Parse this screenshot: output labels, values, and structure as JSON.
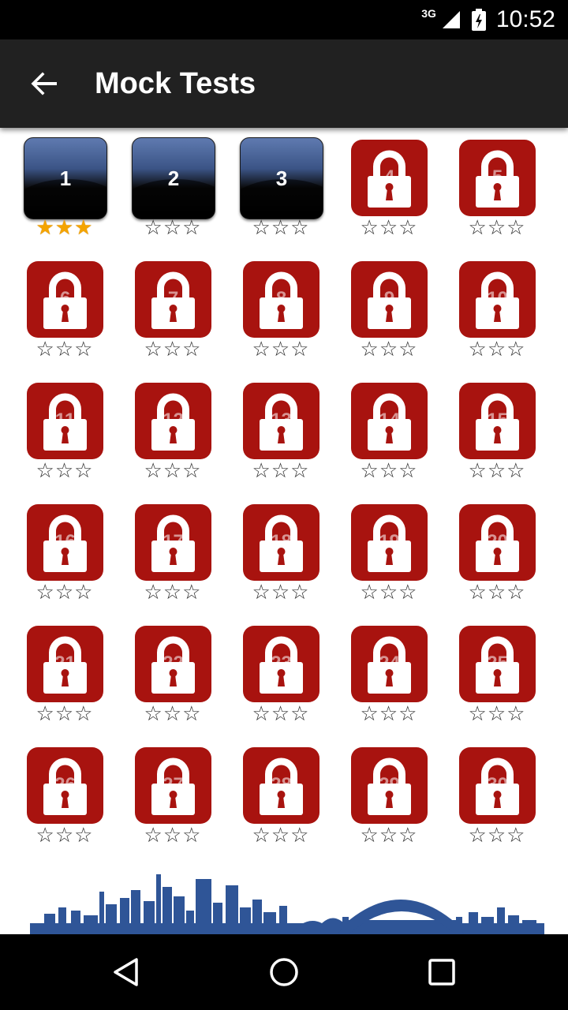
{
  "status": {
    "network": "3G",
    "time": "10:52"
  },
  "toolbar": {
    "title": "Mock Tests"
  },
  "levels": [
    {
      "num": "1",
      "locked": false,
      "stars": 3
    },
    {
      "num": "2",
      "locked": false,
      "stars": 0
    },
    {
      "num": "3",
      "locked": false,
      "stars": 0
    },
    {
      "num": "4",
      "locked": true,
      "stars": 0
    },
    {
      "num": "5",
      "locked": true,
      "stars": 0
    },
    {
      "num": "6",
      "locked": true,
      "stars": 0
    },
    {
      "num": "7",
      "locked": true,
      "stars": 0
    },
    {
      "num": "8",
      "locked": true,
      "stars": 0
    },
    {
      "num": "9",
      "locked": true,
      "stars": 0
    },
    {
      "num": "10",
      "locked": true,
      "stars": 0
    },
    {
      "num": "11",
      "locked": true,
      "stars": 0
    },
    {
      "num": "12",
      "locked": true,
      "stars": 0
    },
    {
      "num": "13",
      "locked": true,
      "stars": 0
    },
    {
      "num": "14",
      "locked": true,
      "stars": 0
    },
    {
      "num": "15",
      "locked": true,
      "stars": 0
    },
    {
      "num": "16",
      "locked": true,
      "stars": 0
    },
    {
      "num": "17",
      "locked": true,
      "stars": 0
    },
    {
      "num": "18",
      "locked": true,
      "stars": 0
    },
    {
      "num": "19",
      "locked": true,
      "stars": 0
    },
    {
      "num": "20",
      "locked": true,
      "stars": 0
    },
    {
      "num": "21",
      "locked": true,
      "stars": 0
    },
    {
      "num": "22",
      "locked": true,
      "stars": 0
    },
    {
      "num": "23",
      "locked": true,
      "stars": 0
    },
    {
      "num": "24",
      "locked": true,
      "stars": 0
    },
    {
      "num": "25",
      "locked": true,
      "stars": 0
    },
    {
      "num": "26",
      "locked": true,
      "stars": 0
    },
    {
      "num": "27",
      "locked": true,
      "stars": 0
    },
    {
      "num": "28",
      "locked": true,
      "stars": 0
    },
    {
      "num": "29",
      "locked": true,
      "stars": 0
    },
    {
      "num": "30",
      "locked": true,
      "stars": 0
    }
  ],
  "star_max": 3,
  "colors": {
    "star_filled": "#f4a400",
    "lock_tile": "#a8130f",
    "open_tile": "#3b5486",
    "toolbar": "#212121",
    "skyline": "#2f5597"
  },
  "icons": {
    "back": "arrow-left-icon",
    "lock": "padlock-icon",
    "nav_back": "triangle-back-icon",
    "nav_home": "circle-home-icon",
    "nav_recents": "square-recents-icon"
  }
}
